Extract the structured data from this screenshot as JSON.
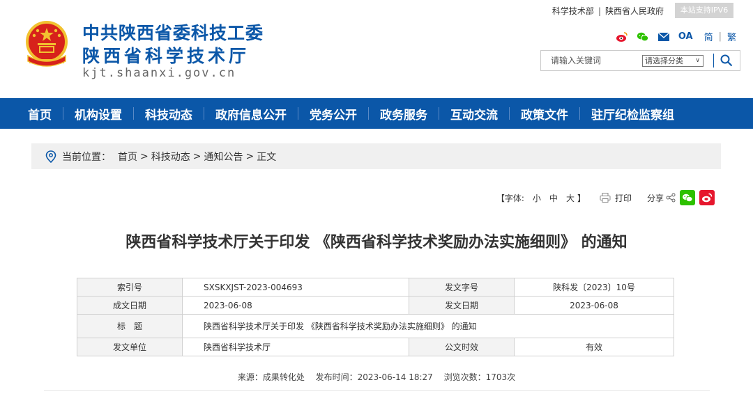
{
  "site": {
    "name_line1": "中共陕西省委科技工委",
    "name_line2": "陕西省科学技术厅",
    "domain": "kjt.shaanxi.gov.cn"
  },
  "top_links": {
    "ministry": "科学技术部",
    "government": "陕西省人民政府",
    "ipv6": "本站支持IPV6"
  },
  "social": {
    "icons": [
      "weibo-icon",
      "wechat-icon",
      "mail-icon",
      "oa-label"
    ],
    "oa": "OA",
    "lang_simplified": "简",
    "lang_traditional": "繁"
  },
  "search": {
    "placeholder": "请输入关键词",
    "category": "请选择分类",
    "category_arrow": "∨"
  },
  "nav": {
    "items": [
      "首页",
      "机构设置",
      "科技动态",
      "政府信息公开",
      "党务公开",
      "政务服务",
      "互动交流",
      "政策文件",
      "驻厅纪检监察组"
    ]
  },
  "breadcrumb": {
    "prefix": "当前位置：",
    "crumbs": [
      "首页",
      "科技动态",
      "通知公告",
      "正文"
    ],
    "separator": ">"
  },
  "tools": {
    "font_label": "【字体:",
    "small": "小",
    "medium": "中",
    "large": "大",
    "font_close": "】",
    "print": "打印",
    "share": "分享"
  },
  "article": {
    "title": "陕西省科学技术厅关于印发 《陕西省科学技术奖励办法实施细则》 的通知"
  },
  "meta": {
    "index_label": "索引号",
    "index_value": "SXSKXJST-2023-004693",
    "docno_label": "发文字号",
    "docno_value": "陕科发〔2023〕10号",
    "created_label": "成文日期",
    "created_value": "2023-06-08",
    "issued_label": "发文日期",
    "issued_value": "2023-06-08",
    "title_label": "标　题",
    "title_value": "陕西省科学技术厅关于印发 《陕西省科学技术奖励办法实施细则》 的通知",
    "unit_label": "发文单位",
    "unit_value": "陕西省科学技术厅",
    "validity_label": "公文时效",
    "validity_value": "有效"
  },
  "source": {
    "source": "来源：成果转化处",
    "published": "发布时间：2023-06-14 18:27",
    "views": "浏览次数：1703次"
  },
  "colors": {
    "brand": "#0b57a8",
    "emblem_red": "#d7221b",
    "emblem_gold": "#f2c230",
    "wechat": "#2dc100",
    "weibo": "#e6162d"
  }
}
